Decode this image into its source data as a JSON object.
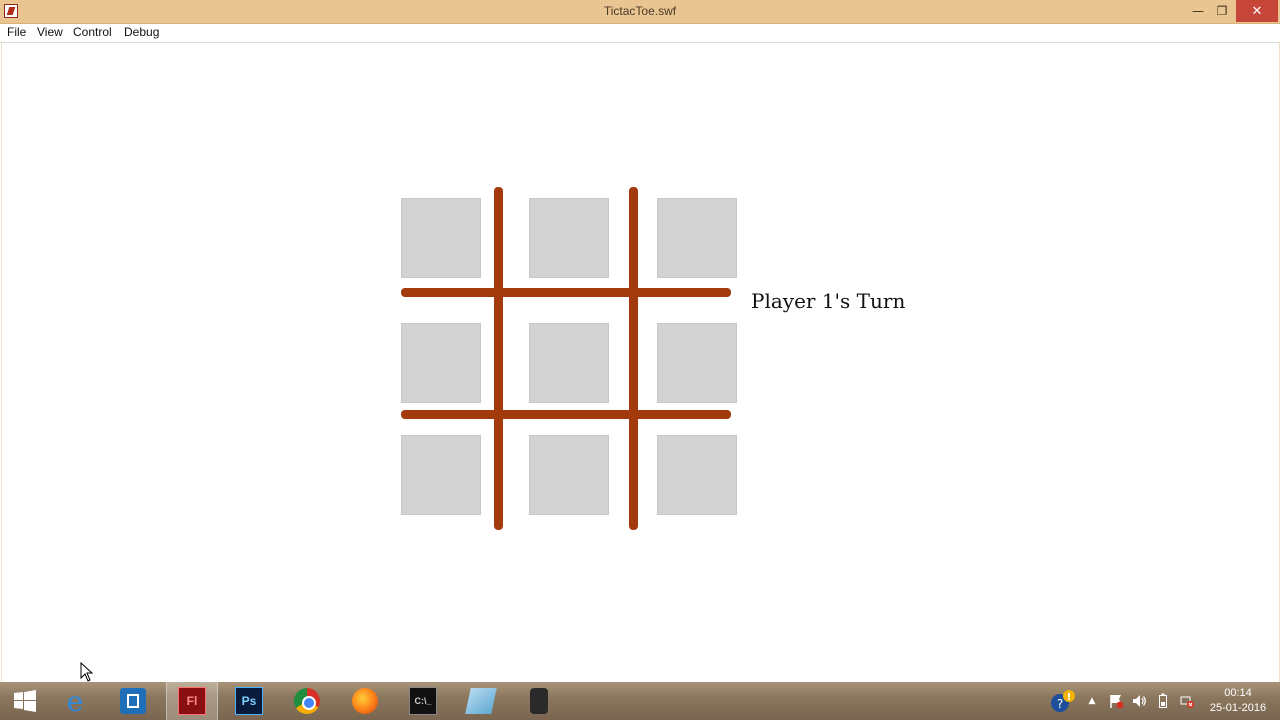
{
  "window": {
    "title": "TictacToe.swf",
    "controls": {
      "minimize": "—",
      "restore": "❐",
      "close": "✕"
    }
  },
  "menu": {
    "items": [
      "File",
      "View",
      "Control",
      "Debug"
    ]
  },
  "game": {
    "status": "Player 1's Turn",
    "cells": [
      "",
      "",
      "",
      "",
      "",
      "",
      "",
      "",
      ""
    ],
    "colors": {
      "cell": "#d3d3d3",
      "grid_line": "#a33a0c"
    }
  },
  "taskbar": {
    "apps": [
      {
        "icon": "windows-start-icon"
      },
      {
        "icon": "internet-explorer-icon",
        "glyph": "e"
      },
      {
        "icon": "store-app-icon"
      },
      {
        "icon": "flash-icon",
        "label": "Fl"
      },
      {
        "icon": "photoshop-icon",
        "label": "Ps"
      },
      {
        "icon": "chrome-icon"
      },
      {
        "icon": "firefox-icon"
      },
      {
        "icon": "command-prompt-icon",
        "label": "C:\\_"
      },
      {
        "icon": "file-manager-icon"
      },
      {
        "icon": "camera-icon"
      }
    ],
    "clock": {
      "time": "00:14",
      "date": "25-01-2016"
    }
  }
}
